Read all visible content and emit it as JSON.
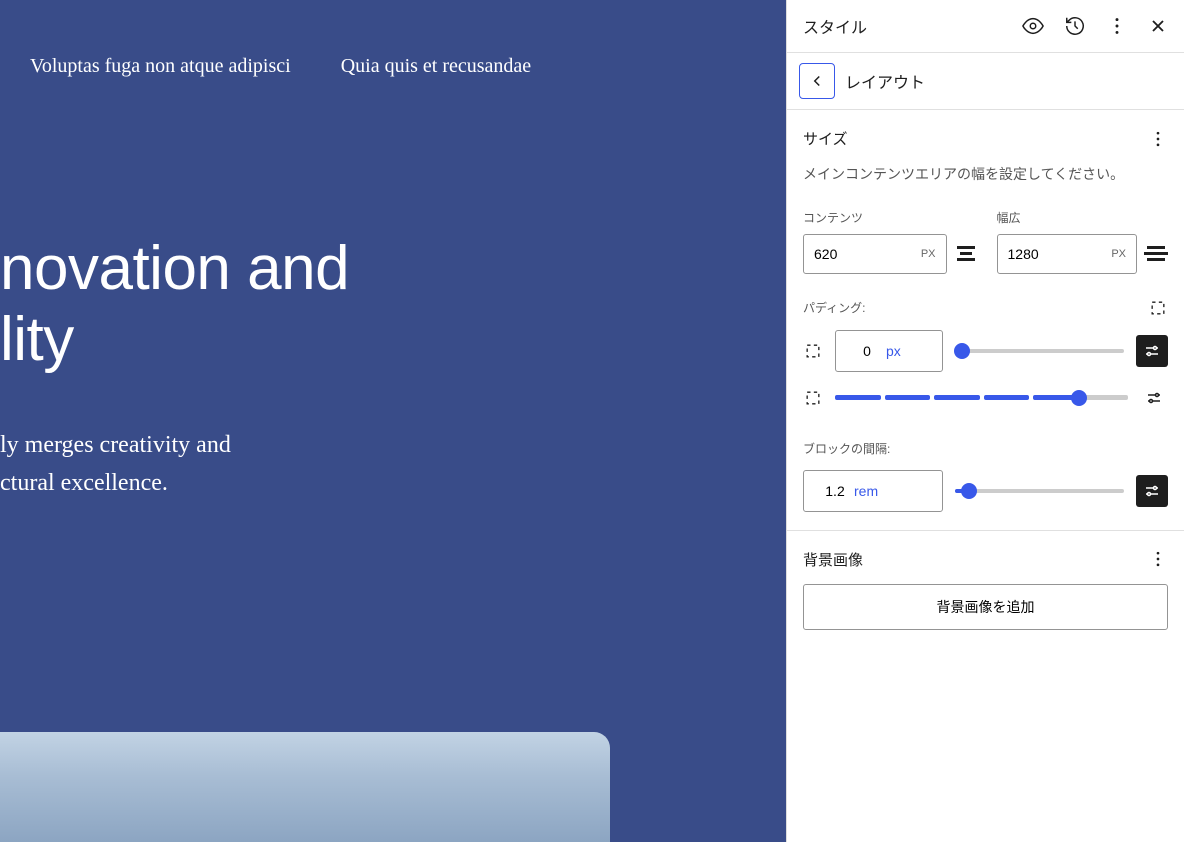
{
  "preview": {
    "nav": {
      "item1": "Voluptas fuga non atque adipisci",
      "item2": "Quia quis et recusandae"
    },
    "title_line1": "novation and",
    "title_line2": "lity",
    "sub_line1": "ly merges creativity and",
    "sub_line2": "ctural excellence."
  },
  "sidebar": {
    "header_title": "スタイル",
    "breadcrumb": "レイアウト",
    "size": {
      "title": "サイズ",
      "description": "メインコンテンツエリアの幅を設定してください。",
      "content_label": "コンテンツ",
      "content_value": "620",
      "content_unit": "PX",
      "wide_label": "幅広",
      "wide_value": "1280",
      "wide_unit": "PX",
      "padding_label": "パディング:",
      "padding_value": "0",
      "padding_unit": "px",
      "block_gap_label": "ブロックの間隔:",
      "block_gap_value": "1.2",
      "block_gap_unit": "rem"
    },
    "bg": {
      "title": "背景画像",
      "button": "背景画像を追加"
    }
  }
}
